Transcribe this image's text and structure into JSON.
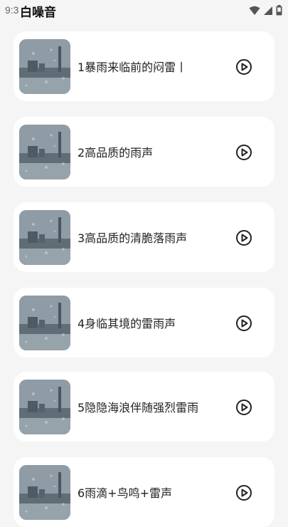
{
  "status_bar": {
    "time": "9:3",
    "icons": [
      "wifi-icon",
      "signal-icon",
      "battery-icon"
    ]
  },
  "app": {
    "title": "白噪音"
  },
  "sounds": [
    {
      "title": "1暴雨来临前的闷雷丨",
      "thumbnail": "rain-window-thumbnail",
      "action_icon": "play-circle-icon"
    },
    {
      "title": "2高品质的雨声",
      "thumbnail": "rain-window-thumbnail",
      "action_icon": "play-circle-icon"
    },
    {
      "title": "3高品质的清脆落雨声",
      "thumbnail": "rain-window-thumbnail",
      "action_icon": "play-circle-icon"
    },
    {
      "title": "4身临其境的雷雨声",
      "thumbnail": "rain-window-thumbnail",
      "action_icon": "play-circle-icon"
    },
    {
      "title": "5隐隐海浪伴随强烈雷雨",
      "thumbnail": "rain-window-thumbnail",
      "action_icon": "play-circle-icon"
    },
    {
      "title": "6雨滴+鸟鸣+雷声",
      "thumbnail": "rain-window-thumbnail",
      "action_icon": "play-circle-icon"
    }
  ],
  "colors": {
    "background": "#f5f5f5",
    "card": "#ffffff",
    "text": "#222222"
  }
}
